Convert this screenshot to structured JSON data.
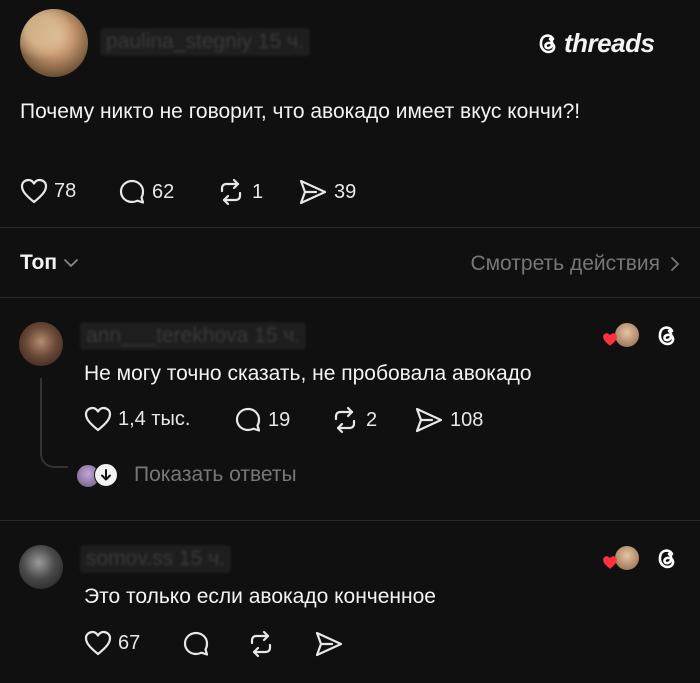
{
  "post": {
    "username": "paulina_stegniy",
    "time": "15 ч.",
    "text": "Почему никто не говорит, что авокадо имеет вкус кончи?!",
    "likes": "78",
    "comments": "62",
    "reposts": "1",
    "shares": "39"
  },
  "brand": {
    "name": "threads"
  },
  "sort": {
    "label": "Топ",
    "activity_link": "Смотреть действия"
  },
  "replies": [
    {
      "username": "ann___terekhova",
      "time": "15 ч.",
      "text": "Не могу точно сказать, не пробовала авокадо",
      "likes": "1,4 тыс.",
      "comments": "19",
      "reposts": "2",
      "shares": "108",
      "show_replies": "Показать ответы"
    },
    {
      "username": "somov.ss",
      "time": "15 ч.",
      "text": "Это только если авокадо конченное",
      "likes": "67"
    }
  ],
  "colors": {
    "background": "#101010",
    "text": "#f3f3f3",
    "muted": "#777777",
    "heart_red": "#ff3040"
  }
}
